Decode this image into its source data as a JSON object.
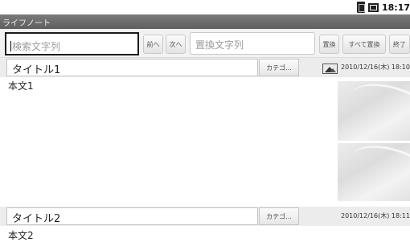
{
  "status_bar": {
    "time": "18:17",
    "icons": [
      "sim-icon",
      "battery-icon"
    ]
  },
  "app": {
    "title": "ライフノート"
  },
  "toolbar": {
    "search_placeholder": "検索文字列",
    "prev_label": "前へ",
    "next_label": "次へ",
    "replace_placeholder": "置換文字列",
    "replace_label": "置換",
    "replace_all_label": "すべて置換",
    "close_label": "終了"
  },
  "notes": [
    {
      "title": "タイトル1",
      "category_label": "カテゴ...",
      "date": "2010/12/16(木) 18:10",
      "body": "本文1",
      "has_image": true,
      "icon": "image-icon"
    },
    {
      "title": "タイトル2",
      "category_label": "カテゴ...",
      "date": "2010/12/16(木) 18:11",
      "body": "本文2",
      "has_image": false
    }
  ],
  "colors": {
    "titlebar": "#6b6b6b",
    "focus_border": "#1c1c1c",
    "header_bg": "#ececec"
  }
}
